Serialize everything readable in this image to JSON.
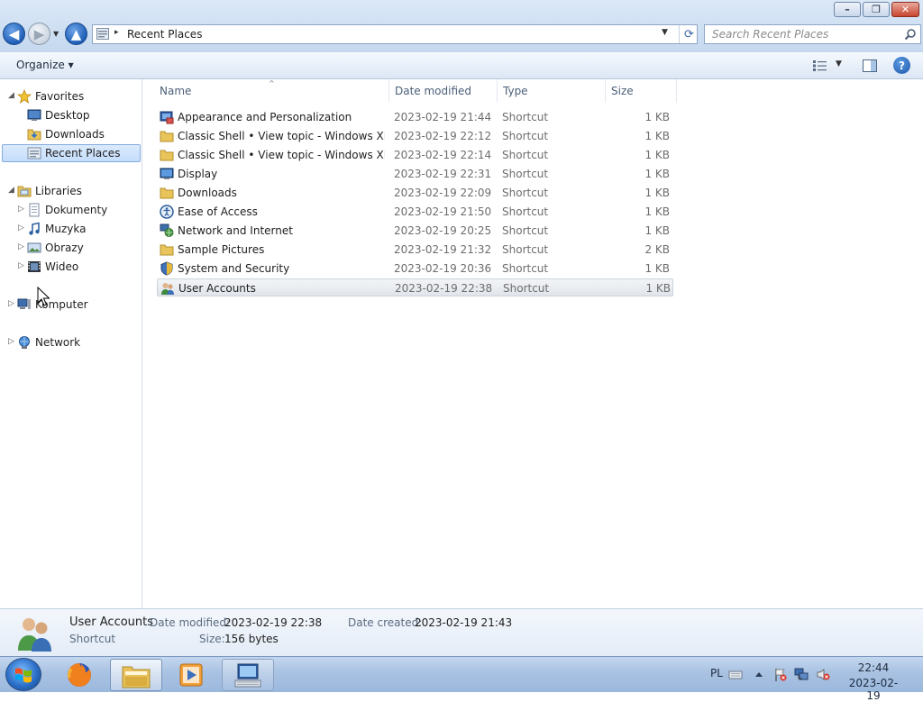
{
  "window": {
    "caption_buttons": {
      "minimize": "–",
      "maximize": "❐",
      "close": "✕"
    }
  },
  "nav": {
    "back_glyph": "◀",
    "forward_glyph": "▶",
    "recent_glyph": "▼",
    "up_glyph": "▲"
  },
  "address": {
    "separator": "▸",
    "location": "Recent Places",
    "dropdown_glyph": "▼",
    "refresh_glyph": "⟳"
  },
  "search": {
    "placeholder": "Search Recent Places"
  },
  "toolbar": {
    "organize_label": "Organize ▾",
    "views_dropdown_glyph": "▼",
    "help_glyph": "?"
  },
  "sidebar": {
    "favorites": {
      "label": "Favorites",
      "items": [
        {
          "label": "Desktop"
        },
        {
          "label": "Downloads"
        },
        {
          "label": "Recent Places",
          "selected": true
        }
      ]
    },
    "libraries": {
      "label": "Libraries",
      "items": [
        {
          "label": "Dokumenty"
        },
        {
          "label": "Muzyka"
        },
        {
          "label": "Obrazy"
        },
        {
          "label": "Wideo"
        }
      ]
    },
    "computer": {
      "label": "Komputer"
    },
    "network": {
      "label": "Network"
    },
    "expanded_glyph": "◢",
    "collapsed_glyph": "▷"
  },
  "columns": {
    "name": "Name",
    "date": "Date modified",
    "type": "Type",
    "size": "Size",
    "sort_glyph": "^"
  },
  "files": [
    {
      "name": "Appearance and Personalization",
      "date": "2023-02-19 21:44",
      "type": "Shortcut",
      "size": "1 KB",
      "icon": "control-panel-icon"
    },
    {
      "name": "Classic Shell • View topic - Windows XP S...",
      "date": "2023-02-19 22:12",
      "type": "Shortcut",
      "size": "1 KB",
      "icon": "folder-icon"
    },
    {
      "name": "Classic Shell • View topic - Windows XP T...",
      "date": "2023-02-19 22:14",
      "type": "Shortcut",
      "size": "1 KB",
      "icon": "folder-icon"
    },
    {
      "name": "Display",
      "date": "2023-02-19 22:31",
      "type": "Shortcut",
      "size": "1 KB",
      "icon": "monitor-icon"
    },
    {
      "name": "Downloads",
      "date": "2023-02-19 22:09",
      "type": "Shortcut",
      "size": "1 KB",
      "icon": "folder-icon"
    },
    {
      "name": "Ease of Access",
      "date": "2023-02-19 21:50",
      "type": "Shortcut",
      "size": "1 KB",
      "icon": "ease-of-access-icon"
    },
    {
      "name": "Network and Internet",
      "date": "2023-02-19 20:25",
      "type": "Shortcut",
      "size": "1 KB",
      "icon": "network-icon"
    },
    {
      "name": "Sample Pictures",
      "date": "2023-02-19 21:32",
      "type": "Shortcut",
      "size": "2 KB",
      "icon": "folder-icon"
    },
    {
      "name": "System and Security",
      "date": "2023-02-19 20:36",
      "type": "Shortcut",
      "size": "1 KB",
      "icon": "shield-icon"
    },
    {
      "name": "User Accounts",
      "date": "2023-02-19 22:38",
      "type": "Shortcut",
      "size": "1 KB",
      "icon": "users-icon",
      "selected": true
    }
  ],
  "details": {
    "name": "User Accounts",
    "type": "Shortcut",
    "date_modified_label": "Date modified:",
    "date_modified": "2023-02-19 22:38",
    "date_created_label": "Date created:",
    "date_created": "2023-02-19 21:43",
    "size_label": "Size:",
    "size": "156 bytes"
  },
  "taskbar": {
    "apps": [
      {
        "name": "Firefox",
        "state": "pinned"
      },
      {
        "name": "Windows Explorer",
        "state": "active"
      },
      {
        "name": "Media Player",
        "state": "pinned"
      },
      {
        "name": "Remote Desktop",
        "state": "open"
      }
    ],
    "language": "PL",
    "time": "22:44",
    "date": "2023-02-19"
  },
  "colors": {
    "accent": "#1f5fb8",
    "selection": "#c4ddfc",
    "titlebar": "#cfe0f3",
    "taskbar": "#a9c2e2"
  }
}
